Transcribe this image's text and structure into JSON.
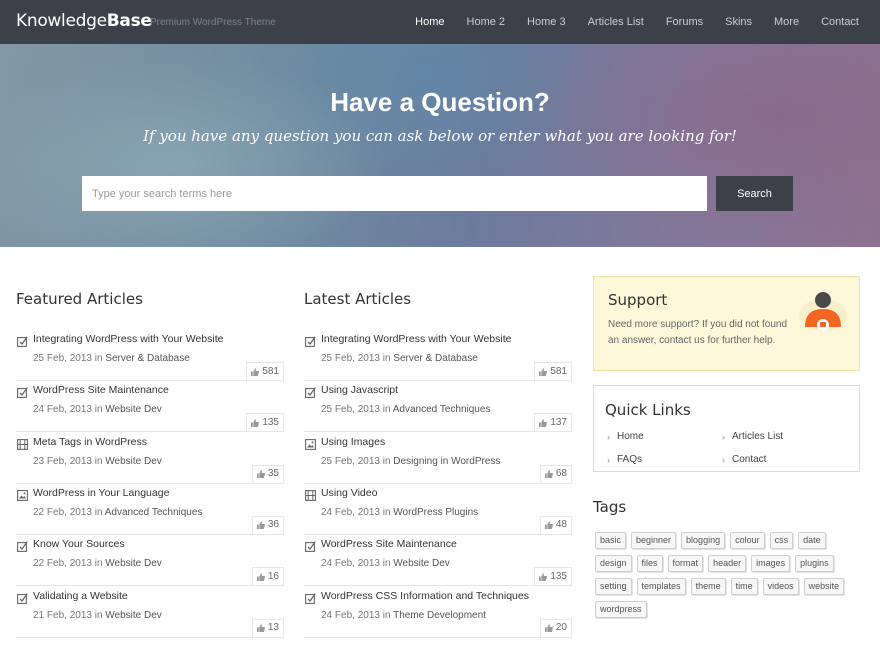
{
  "header": {
    "logo_light": "Knowledge",
    "logo_bold": "Base",
    "tagline": "Premium WordPress Theme",
    "nav": [
      "Home",
      "Home 2",
      "Home 3",
      "Articles List",
      "Forums",
      "Skins",
      "More",
      "Contact"
    ]
  },
  "hero": {
    "title": "Have a Question?",
    "subtitle": "If you have any question you can ask below or enter what you are looking for!",
    "search_placeholder": "Type your search terms here",
    "search_button": "Search"
  },
  "featured": {
    "title": "Featured Articles",
    "articles": [
      {
        "icon": "edit-icon",
        "title": "Integrating WordPress with Your Website",
        "date": "25 Feb, 2013",
        "category": "Server & Database",
        "likes": "581"
      },
      {
        "icon": "edit-icon",
        "title": "WordPress Site Maintenance",
        "date": "24 Feb, 2013",
        "category": "Website Dev",
        "likes": "135"
      },
      {
        "icon": "video-icon",
        "title": "Meta Tags in WordPress",
        "date": "23 Feb, 2013",
        "category": "Website Dev",
        "likes": "35"
      },
      {
        "icon": "image-icon",
        "title": "WordPress in Your Language",
        "date": "22 Feb, 2013",
        "category": "Advanced Techniques",
        "likes": "36"
      },
      {
        "icon": "edit-icon",
        "title": "Know Your Sources",
        "date": "22 Feb, 2013",
        "category": "Website Dev",
        "likes": "16"
      },
      {
        "icon": "edit-icon",
        "title": "Validating a Website",
        "date": "21 Feb, 2013",
        "category": "Website Dev",
        "likes": "13"
      }
    ]
  },
  "latest": {
    "title": "Latest Articles",
    "articles": [
      {
        "icon": "edit-icon",
        "title": "Integrating WordPress with Your Website",
        "date": "25 Feb, 2013",
        "category": "Server & Database",
        "likes": "581"
      },
      {
        "icon": "edit-icon",
        "title": "Using Javascript",
        "date": "25 Feb, 2013",
        "category": "Advanced Techniques",
        "likes": "137"
      },
      {
        "icon": "image-icon",
        "title": "Using Images",
        "date": "25 Feb, 2013",
        "category": "Designing in WordPress",
        "likes": "68"
      },
      {
        "icon": "video-icon",
        "title": "Using Video",
        "date": "24 Feb, 2013",
        "category": "WordPress Plugins",
        "likes": "48"
      },
      {
        "icon": "edit-icon",
        "title": "WordPress Site Maintenance",
        "date": "24 Feb, 2013",
        "category": "Website Dev",
        "likes": "135"
      },
      {
        "icon": "edit-icon",
        "title": "WordPress CSS Information and Techniques",
        "date": "24 Feb, 2013",
        "category": "Theme Development",
        "likes": "20"
      }
    ]
  },
  "meta_in": "in",
  "support": {
    "title": "Support",
    "text": "Need more support? If you did not found an answer, contact us for further help."
  },
  "quick_links": {
    "title": "Quick Links",
    "links": [
      "Home",
      "Articles List",
      "FAQs",
      "Contact"
    ]
  },
  "tags": {
    "title": "Tags",
    "items": [
      "basic",
      "beginner",
      "blogging",
      "colour",
      "css",
      "date",
      "design",
      "files",
      "format",
      "header",
      "images",
      "plugins",
      "setting",
      "templates",
      "theme",
      "time",
      "videos",
      "website",
      "wordpress"
    ]
  },
  "colors": {
    "header_bg": "#3c4149",
    "support_bg": "#fcf8d9",
    "support_accent": "#f26522"
  }
}
